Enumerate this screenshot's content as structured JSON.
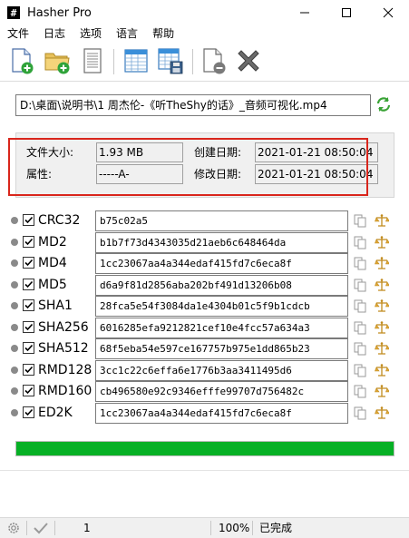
{
  "window": {
    "title": "Hasher Pro",
    "app_icon_glyph": "#"
  },
  "menu": [
    "文件",
    "日志",
    "选项",
    "语言",
    "帮助"
  ],
  "toolbar": {
    "icons": [
      "add-file-icon",
      "add-folder-icon",
      "document-icon",
      "table-icon",
      "save-table-icon",
      "remove-file-icon",
      "clear-icon"
    ]
  },
  "file": {
    "path": "D:\\桌面\\说明书\\1 周杰伦-《听TheShy的话》_音频可视化.mp4"
  },
  "info": {
    "size_label": "文件大小:",
    "size_value": "1.93 MB",
    "attr_label": "属性:",
    "attr_value": "-----A-",
    "created_label": "创建日期:",
    "created_value": "2021-01-21 08:50:04",
    "modified_label": "修改日期:",
    "modified_value": "2021-01-21 08:50:04"
  },
  "hashes": [
    {
      "algo": "CRC32",
      "value": "b75c02a5"
    },
    {
      "algo": "MD2",
      "value": "b1b7f73d4343035d21aeb6c648464da"
    },
    {
      "algo": "MD4",
      "value": "1cc23067aa4a344edaf415fd7c6eca8f"
    },
    {
      "algo": "MD5",
      "value": "d6a9f81d2856aba202bf491d13206b08"
    },
    {
      "algo": "SHA1",
      "value": "28fca5e54f3084da1e4304b01c5f9b1cdcb"
    },
    {
      "algo": "SHA256",
      "value": "6016285efa9212821cef10e4fcc57a634a3"
    },
    {
      "algo": "SHA512",
      "value": "68f5eba54e597ce167757b975e1dd865b23"
    },
    {
      "algo": "RMD128",
      "value": "3cc1c22c6effa6e1776b3aa3411495d6"
    },
    {
      "algo": "RMD160",
      "value": "cb496580e92c9346efffe99707d756482c"
    },
    {
      "algo": "ED2K",
      "value": "1cc23067aa4a344edaf415fd7c6eca8f"
    }
  ],
  "progress": {
    "fraction": 1.0
  },
  "status": {
    "count": "1",
    "zoom": "100%",
    "state": "已完成"
  },
  "colors": {
    "progress": "#06b025",
    "highlight": "#d9261c"
  }
}
